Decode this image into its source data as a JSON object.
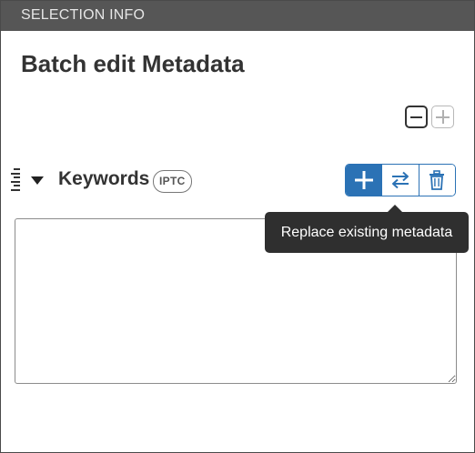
{
  "panel": {
    "header": "SELECTION INFO",
    "title": "Batch edit Metadata"
  },
  "controls": {
    "collapse_all_icon": "minus-square-icon",
    "expand_all_icon": "plus-square-icon"
  },
  "field": {
    "label": "Keywords",
    "badge": "IPTC",
    "value": "",
    "actions": [
      {
        "icon": "plus-icon",
        "active": true
      },
      {
        "icon": "swap-arrows-icon",
        "active": false
      },
      {
        "icon": "trash-icon",
        "active": false
      }
    ]
  },
  "tooltip": {
    "text": "Replace existing metadata"
  },
  "colors": {
    "accent": "#2b72b5",
    "header_bg": "#565656",
    "tooltip_bg": "#2f2f2f"
  }
}
